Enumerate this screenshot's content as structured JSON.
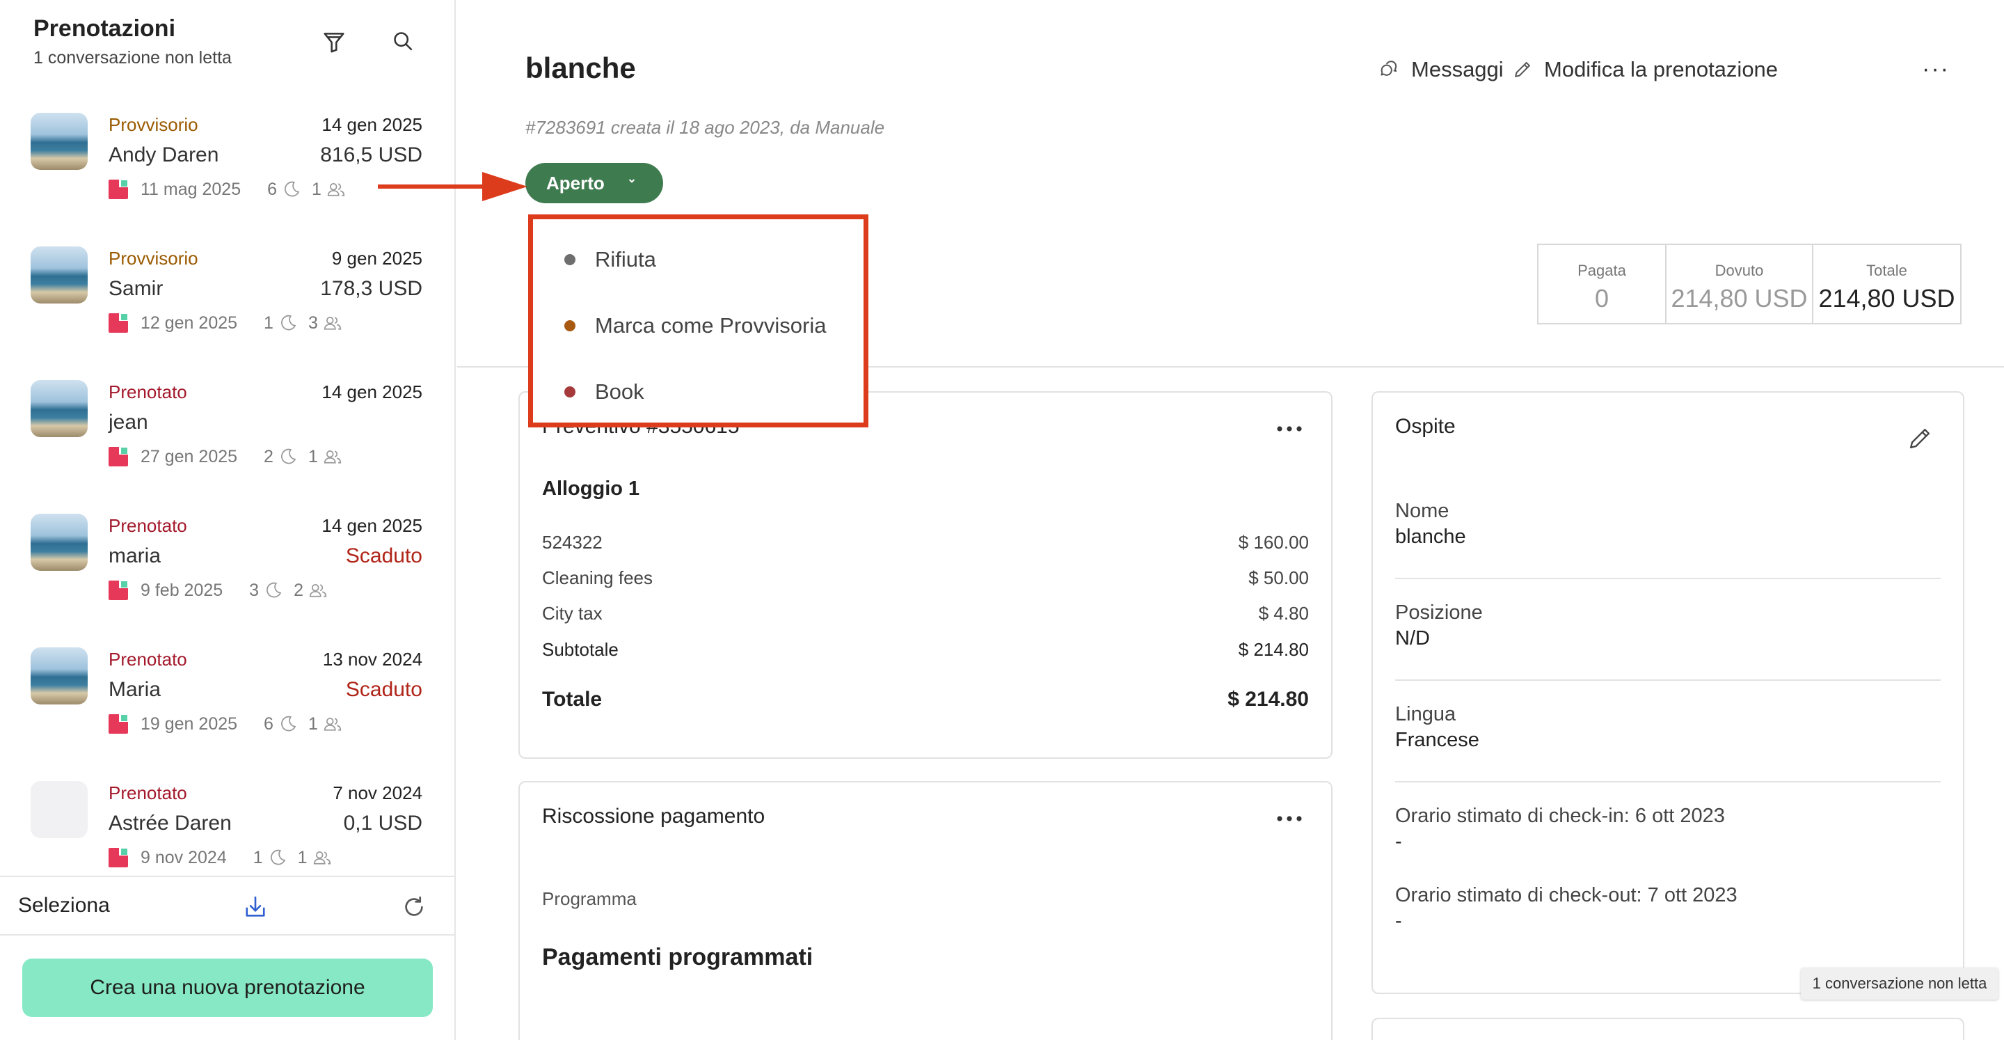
{
  "sidebar": {
    "title": "Prenotazioni",
    "subtitle": "1 conversazione non letta",
    "items": [
      {
        "status": "Provvisorio",
        "status_color": "#9a5a00",
        "date": "14 gen 2025",
        "name": "Andy Daren",
        "amount": "816,5 USD",
        "overdue": false,
        "check_in": "11 mag 2025",
        "nights": "6",
        "guests": "1",
        "has_photo": true
      },
      {
        "status": "Provvisorio",
        "status_color": "#9a5a00",
        "date": "9 gen 2025",
        "name": "Samir",
        "amount": "178,3 USD",
        "overdue": false,
        "check_in": "12 gen 2025",
        "nights": "1",
        "guests": "3",
        "has_photo": true
      },
      {
        "status": "Prenotato",
        "status_color": "#a3192b",
        "date": "14 gen 2025",
        "name": "jean",
        "amount": "",
        "overdue": false,
        "check_in": "27 gen 2025",
        "nights": "2",
        "guests": "1",
        "has_photo": true
      },
      {
        "status": "Prenotato",
        "status_color": "#a3192b",
        "date": "14 gen 2025",
        "name": "maria",
        "amount": "Scaduto",
        "overdue": true,
        "check_in": "9 feb 2025",
        "nights": "3",
        "guests": "2",
        "has_photo": true
      },
      {
        "status": "Prenotato",
        "status_color": "#a3192b",
        "date": "13 nov 2024",
        "name": "Maria",
        "amount": "Scaduto",
        "overdue": true,
        "check_in": "19 gen 2025",
        "nights": "6",
        "guests": "1",
        "has_photo": true
      },
      {
        "status": "Prenotato",
        "status_color": "#a3192b",
        "date": "7 nov 2024",
        "name": "Astrée Daren",
        "amount": "0,1 USD",
        "overdue": false,
        "check_in": "9 nov 2024",
        "nights": "1",
        "guests": "1",
        "has_photo": false
      }
    ],
    "footer": {
      "select_label": "Seleziona",
      "create_label": "Crea una nuova prenotazione"
    }
  },
  "main": {
    "guest_name": "blanche",
    "created_info": "#7283691 creata il 18 ago 2023, da Manuale",
    "actions": {
      "messages": "Messaggi",
      "edit": "Modifica la prenotazione",
      "more": "···"
    },
    "status_button": "Aperto",
    "status_options": [
      {
        "label": "Rifiuta",
        "color": "#6e6e6e"
      },
      {
        "label": "Marca come Provvisoria",
        "color": "#a85a12"
      },
      {
        "label": "Book",
        "color": "#a63a3a"
      }
    ],
    "totals": {
      "paid_label": "Pagata",
      "paid_value": "0",
      "due_label": "Dovuto",
      "due_value": "214,80 USD",
      "total_label": "Totale",
      "total_value": "214,80 USD"
    },
    "quote": {
      "title": "Preventivo #3550615",
      "section": "Alloggio 1",
      "lines": [
        {
          "label": "524322",
          "value": "$ 160.00"
        },
        {
          "label": "Cleaning fees",
          "value": "$ 50.00"
        },
        {
          "label": "City tax",
          "value": "$ 4.80"
        }
      ],
      "subtotal_label": "Subtotale",
      "subtotal_value": "$ 214.80",
      "total_label": "Totale",
      "total_value": "$ 214.80"
    },
    "payment": {
      "title": "Riscossione pagamento",
      "program_label": "Programma",
      "scheduled_title": "Pagamenti programmati"
    },
    "guest": {
      "title": "Ospite",
      "name_label": "Nome",
      "name_value": "blanche",
      "position_label": "Posizione",
      "position_value": "N/D",
      "language_label": "Lingua",
      "language_value": "Francese",
      "checkin_label": "Orario stimato di check-in: 6 ott 2023",
      "checkin_value": "-",
      "checkout_label": "Orario stimato di check-out: 7 ott 2023",
      "checkout_value": "-"
    },
    "tooltip": "1 conversazione non letta"
  },
  "colors": {
    "accent_green": "#3e7b4f",
    "create_button": "#86e8c5",
    "highlight_red": "#dc3c1b",
    "overdue_red": "#b02418"
  },
  "icons": [
    "filter-icon",
    "search-icon",
    "download-icon",
    "refresh-icon",
    "chat-icon",
    "pencil-icon",
    "moon-icon",
    "people-icon",
    "chevron-down-icon",
    "more-dots-icon"
  ]
}
